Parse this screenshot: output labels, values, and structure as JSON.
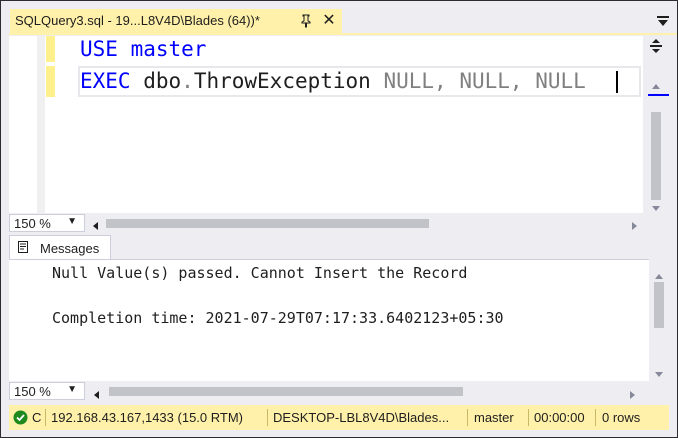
{
  "tab": {
    "title": "SQLQuery3.sql - 19...L8V4D\\Blades (64))*",
    "pin_icon": "pin-icon",
    "close_label": "✕"
  },
  "editor": {
    "lines": [
      {
        "kw": "USE",
        "rest": " master"
      },
      {
        "kw": "EXEC",
        "obj": " dbo",
        "dot": ".",
        "proc": "ThrowException",
        "args": " NULL, NULL, NULL"
      }
    ],
    "zoom": "150 %"
  },
  "messages": {
    "tab_label": "Messages",
    "lines": [
      "Null Value(s) passed. Cannot Insert the Record",
      "",
      "Completion time: 2021-07-29T07:17:33.6402123+05:30"
    ],
    "zoom": "150 %"
  },
  "status": {
    "state": "C",
    "server": "192.168.43.167,1433 (15.0 RTM)",
    "login": "DESKTOP-LBL8V4D\\Blades...",
    "database": "master",
    "elapsed": "00:00:00",
    "rows": "0 rows"
  },
  "colors": {
    "tab_active": "#fff1a9",
    "keyword": "#0000ff",
    "null_gray": "#808080",
    "status_ok": "#1e8a1e"
  }
}
